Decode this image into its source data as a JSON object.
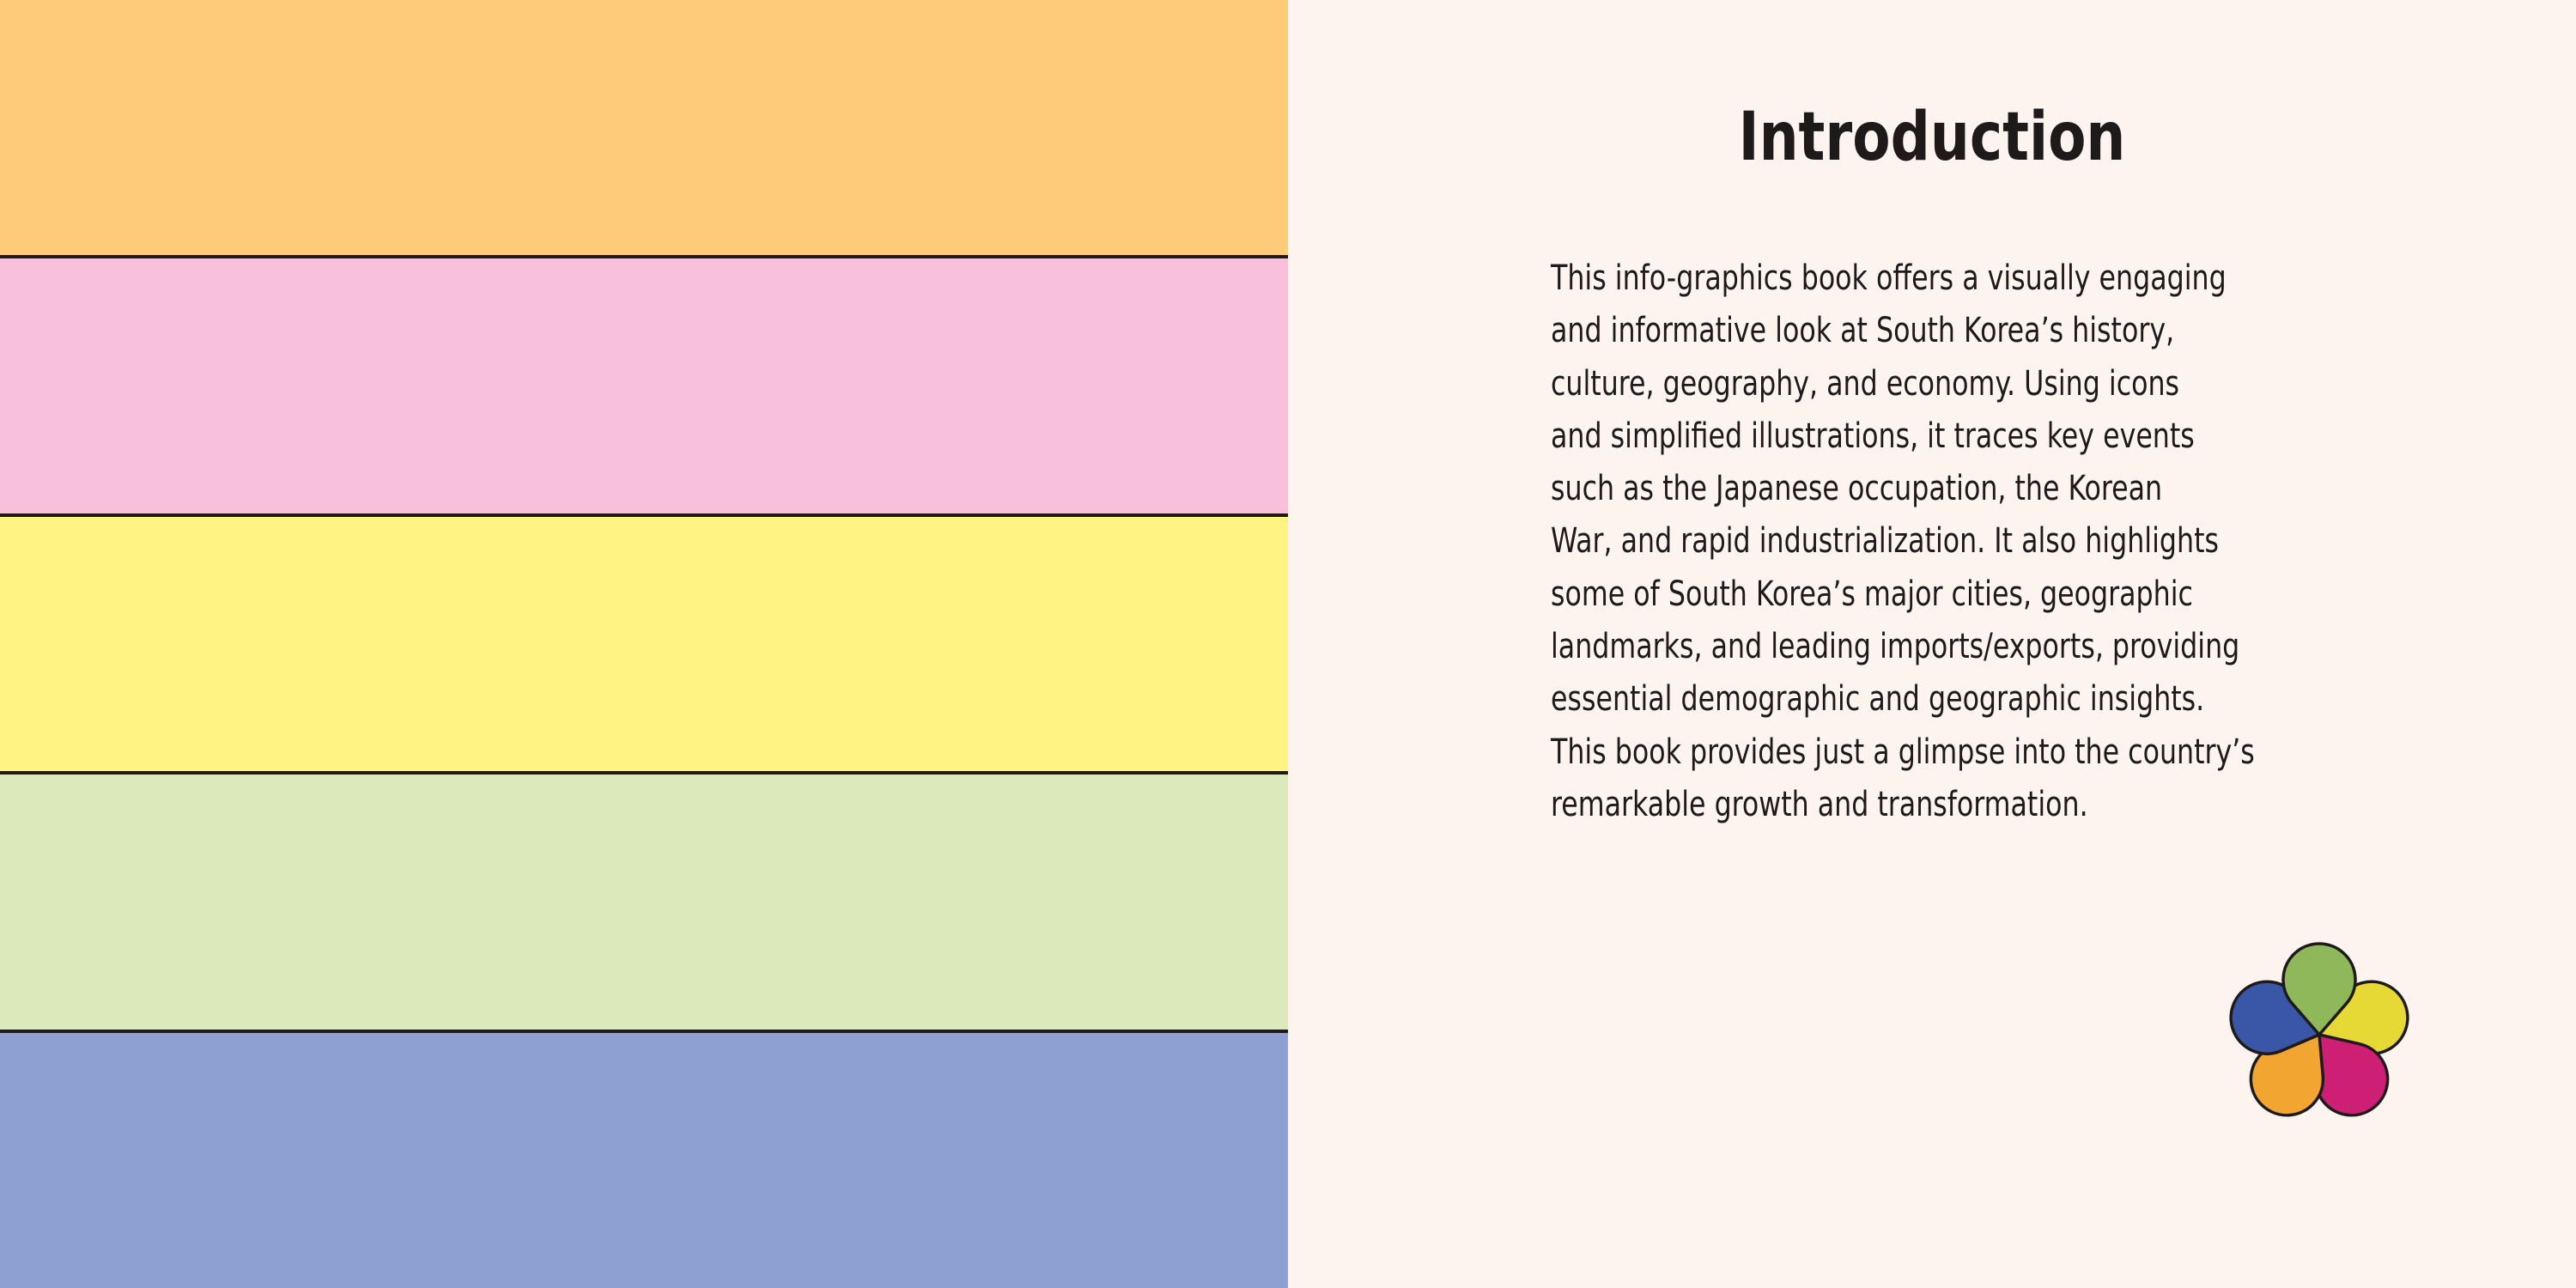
{
  "left_page": {
    "stripes": [
      {
        "name": "orange-stripe",
        "color": "#fecb78"
      },
      {
        "name": "pink-stripe",
        "color": "#f8c0da"
      },
      {
        "name": "yellow-stripe",
        "color": "#fff383"
      },
      {
        "name": "green-stripe",
        "color": "#dbe9bb"
      },
      {
        "name": "blue-stripe",
        "color": "#8e9fd1"
      }
    ]
  },
  "right_page": {
    "title": "Introduction",
    "body_lines": [
      "This info-graphics book offers a visually engaging",
      "and informative look at South Korea’s history,",
      "culture, geography, and economy. Using icons",
      "and simplified illustrations, it traces key events",
      "such as the Japanese occupation, the Korean",
      "War, and rapid industrialization. It also highlights",
      "some of South Korea’s major cities, geographic",
      "landmarks, and leading imports/exports, providing",
      "essential demographic and geographic insights.",
      "This book provides just a glimpse into the country’s",
      "remarkable growth and transformation."
    ],
    "flower_logo": {
      "icon": "five-petal-flower-icon",
      "petal_colors": [
        "#e7d935",
        "#cd1f74",
        "#f2a531",
        "#3a56a6",
        "#8fb85b"
      ],
      "outline_color": "#1f1a1a"
    }
  },
  "page_background": "#fdf4f0"
}
